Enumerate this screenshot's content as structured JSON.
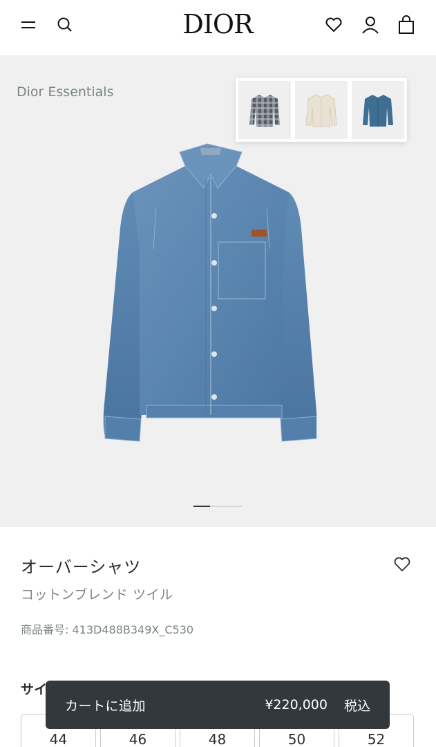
{
  "header": {
    "logo": "DIOR",
    "icons": [
      "menu-icon",
      "search-icon",
      "heart-icon",
      "user-icon",
      "bag-icon"
    ]
  },
  "gallery": {
    "collection": "Dior Essentials",
    "swatches": [
      "check-shirt",
      "cream-jacket",
      "blue-jacket"
    ],
    "image_index": 1,
    "image_count": 2
  },
  "product": {
    "title": "オーバーシャツ",
    "subtitle": "コットンブレンド ツイル",
    "reference": "商品番号: 413D488B349X_C530"
  },
  "sizes": {
    "label": "サイ",
    "options": [
      "44",
      "46",
      "48",
      "50",
      "52"
    ]
  },
  "cart": {
    "label": "カートに追加",
    "price": "¥220,000",
    "tax": "税込"
  },
  "colors": {
    "accent": "#33383c",
    "muted": "#7b8487",
    "gallery_bg": "#f0f0f0",
    "denim": "#5b86b0"
  }
}
